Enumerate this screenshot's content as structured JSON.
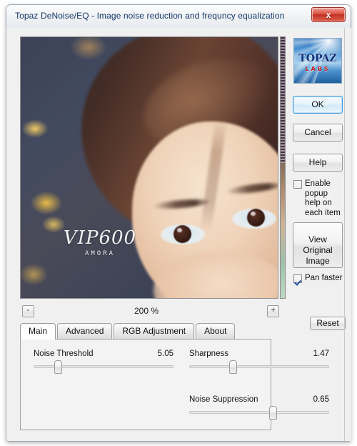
{
  "window": {
    "title": "Topaz DeNoise/EQ - Image noise reduction and frequncy equalization",
    "close_label": "x"
  },
  "preview": {
    "watermark_main": "VIP600",
    "watermark_sub": "AMORA",
    "scrollbar_name": "preview-vertical-scrollbar"
  },
  "zoom": {
    "out_label": "-",
    "in_label": "+",
    "level": "200 %"
  },
  "tabs": [
    {
      "label": "Main",
      "active": true
    },
    {
      "label": "Advanced",
      "active": false
    },
    {
      "label": "RGB Adjustment",
      "active": false
    },
    {
      "label": "About",
      "active": false
    }
  ],
  "sliders": [
    {
      "label": "Noise Threshold",
      "value": "5.05",
      "percent": 17
    },
    {
      "label": "Sharpness",
      "value": "1.47",
      "percent": 31
    },
    {
      "label": "Noise Suppression",
      "value": "0.65",
      "percent": 60
    }
  ],
  "logo": {
    "brand": "TOPAZ",
    "sub": "LABS"
  },
  "buttons": {
    "ok": "OK",
    "cancel": "Cancel",
    "help": "Help",
    "view_original": "View Original Image",
    "reset": "Reset"
  },
  "checkboxes": {
    "enable_popup_help": {
      "label": "Enable popup help on each item",
      "checked": false
    },
    "pan_faster": {
      "label": "Pan faster",
      "checked": true
    }
  },
  "colors": {
    "title_text": "#15376b",
    "accent_blue": "#3c9adf",
    "close_red": "#c13325",
    "logo_blue": "#16317a",
    "logo_red": "#c32222"
  }
}
